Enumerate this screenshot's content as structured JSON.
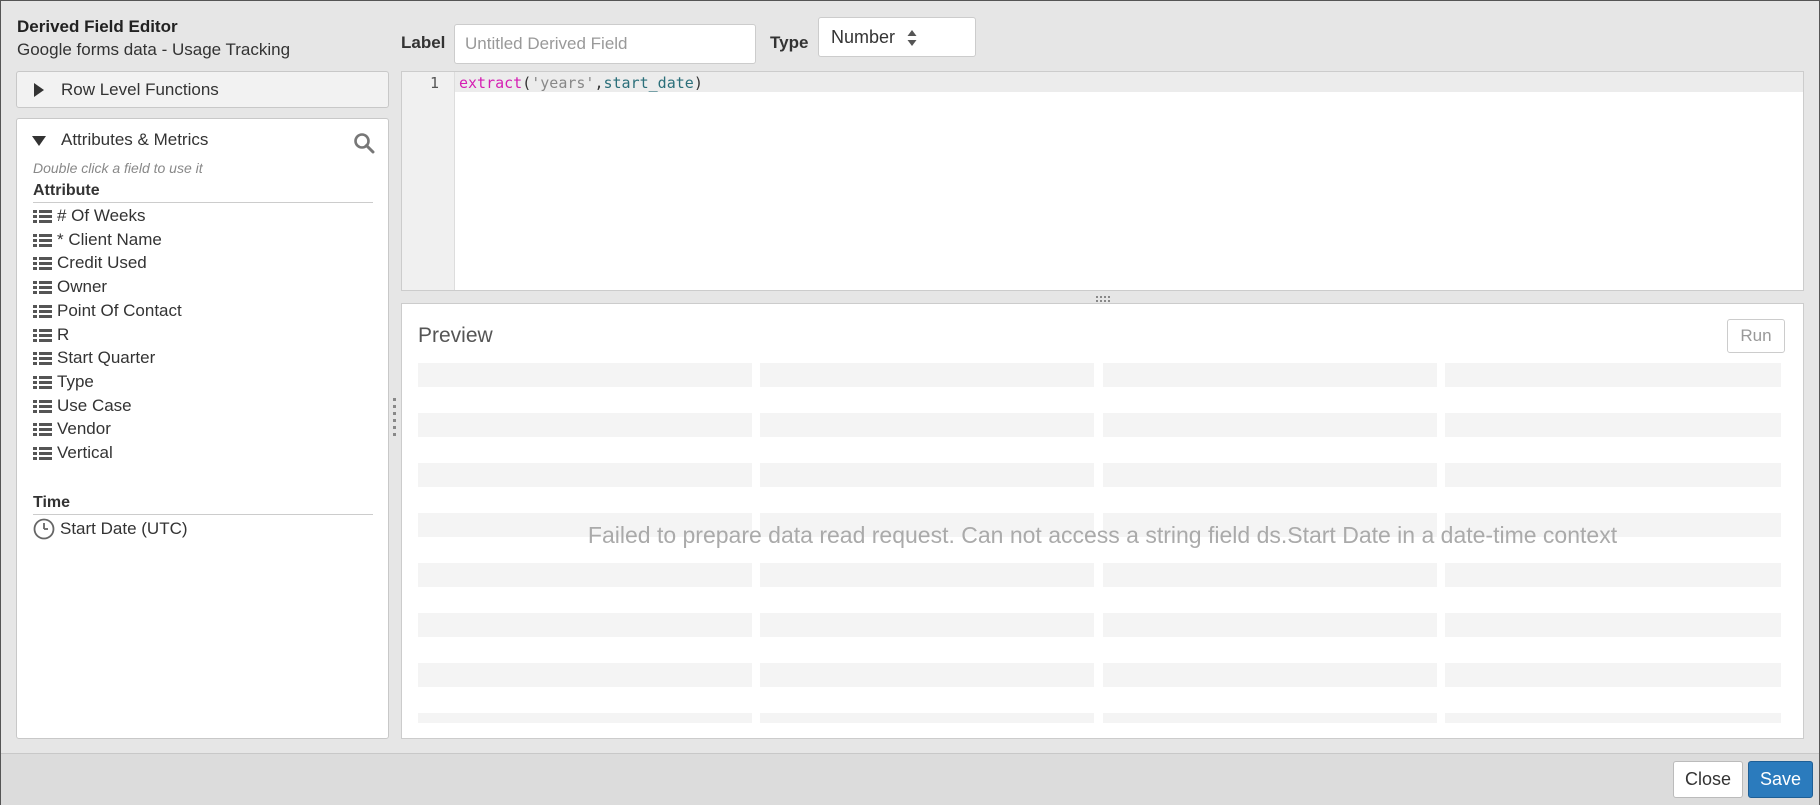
{
  "editor": {
    "title": "Derived Field Editor",
    "subtitle": "Google forms data - Usage Tracking"
  },
  "row_level_functions": {
    "label": "Row Level Functions"
  },
  "attributes_metrics": {
    "heading": "Attributes & Metrics",
    "hint": "Double click a field to use it",
    "attribute_section": "Attribute",
    "attributes": [
      "# Of Weeks",
      "* Client Name",
      "Credit Used",
      "Owner",
      "Point Of Contact",
      "R",
      "Start Quarter",
      "Type",
      "Use Case",
      "Vendor",
      "Vertical"
    ],
    "time_section": "Time",
    "time_fields": [
      "Start Date (UTC)"
    ]
  },
  "form": {
    "label_caption": "Label",
    "label_placeholder": "Untitled Derived Field",
    "type_caption": "Type",
    "type_value": "Number"
  },
  "code": {
    "line_number": "1",
    "fn": "extract",
    "open": "(",
    "arg1": "'years'",
    "comma": ",",
    "arg2": "start_date",
    "close": ")"
  },
  "preview": {
    "title": "Preview",
    "run_label": "Run",
    "error": "Failed to prepare data read request. Can not access a string field ds.Start Date in a date-time context"
  },
  "footer": {
    "close_label": "Close",
    "save_label": "Save"
  },
  "colors": {
    "accent": "#2b7bbd",
    "function_token": "#d51fb3",
    "variable_token": "#2b6f7a"
  }
}
